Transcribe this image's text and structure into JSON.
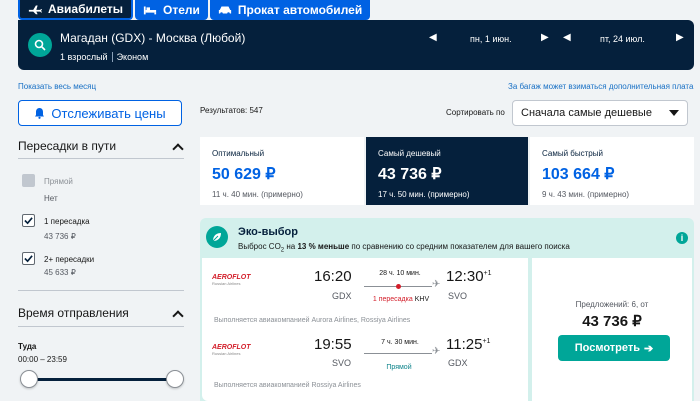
{
  "tabs": [
    {
      "label": "Авиабилеты",
      "icon": "plane-icon"
    },
    {
      "label": "Отели",
      "icon": "bed-icon"
    },
    {
      "label": "Прокат автомобилей",
      "icon": "car-icon"
    }
  ],
  "search": {
    "route": "Магадан (GDX) - Москва (Любой)",
    "passengers": "1 взрослый",
    "cabin": "Эконом",
    "depart_date": "пн, 1 июн.",
    "return_date": "пт, 24 июл."
  },
  "links": {
    "whole_month": "Показать весь месяц",
    "baggage_note": "За багаж может взиматься дополнительная плата"
  },
  "track_button": "Отслеживать цены",
  "results_count": "Результатов: 547",
  "sort": {
    "label": "Сортировать по",
    "value": "Сначала самые дешевые"
  },
  "filters": {
    "stops_title": "Пересадки в пути",
    "options": [
      {
        "label": "Прямой",
        "price": "Нет",
        "checked": false,
        "disabled": true
      },
      {
        "label": "1 пересадка",
        "price": "43 736 ₽",
        "checked": true,
        "disabled": false
      },
      {
        "label": "2+ пересадки",
        "price": "45 633 ₽",
        "checked": true,
        "disabled": false
      }
    ],
    "time_title": "Время отправления",
    "direction": "Туда",
    "range": "00:00 – 23:59"
  },
  "summary": [
    {
      "label": "Оптимальный",
      "price": "50 629 ₽",
      "duration": "11 ч. 40 мин. (примерно)"
    },
    {
      "label": "Самый дешевый",
      "price": "43 736 ₽",
      "duration": "17 ч. 50 мин. (примерно)"
    },
    {
      "label": "Самый быстрый",
      "price": "103 664 ₽",
      "duration": "9 ч. 43 мин. (примерно)"
    }
  ],
  "eco": {
    "title": "Эко-выбор",
    "desc_before": "Выброс CO",
    "desc_sub": "2",
    "desc_mid": " на ",
    "desc_bold": "13 % меньше",
    "desc_after": " по сравнению со средним показателем для вашего поиска"
  },
  "itinerary": {
    "outbound": {
      "airline": "AEROFLOT",
      "airline_sub": "Russian Airlines",
      "dep_time": "16:20",
      "dep_code": "GDX",
      "duration": "28 ч. 10 мин.",
      "stops": "1 пересадка",
      "stop_code": "KHV",
      "arr_time": "12:30",
      "arr_offset": "+1",
      "arr_code": "SVO",
      "operated": "Выполняется авиакомпанией Aurora Airlines, Rossiya Airlines"
    },
    "inbound": {
      "airline": "AEROFLOT",
      "airline_sub": "Russian Airlines",
      "dep_time": "19:55",
      "dep_code": "SVO",
      "duration": "7 ч. 30 мин.",
      "stops": "Прямой",
      "arr_time": "11:25",
      "arr_offset": "+1",
      "arr_code": "GDX",
      "operated": "Выполняется авиакомпанией Rossiya Airlines"
    },
    "offers": "Предложений: 6, от",
    "price": "43 736 ₽",
    "button": "Посмотреть"
  },
  "colors": {
    "navy": "#05203c",
    "blue": "#0062e3",
    "teal": "#00a698",
    "eco_bg": "#d3f0ec",
    "red": "#d31e2a"
  }
}
